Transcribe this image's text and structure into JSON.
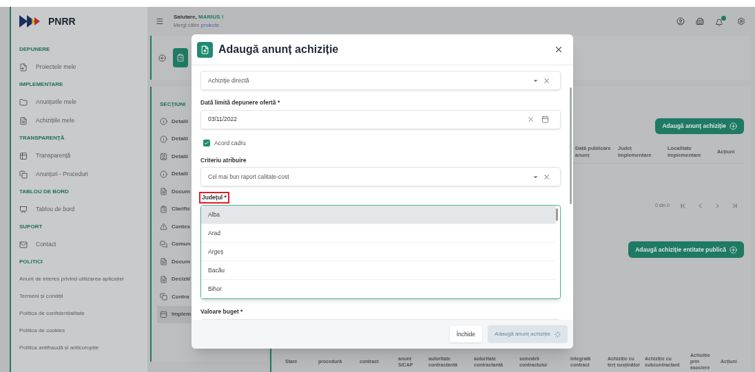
{
  "sidebar": {
    "logo": "PNRR",
    "groups": [
      {
        "title": "DEPUNERE",
        "items": [
          "Proiectele mele"
        ]
      },
      {
        "title": "IMPLEMENTARE",
        "items": [
          "Anunțurile mele",
          "Achizițiile mele"
        ]
      },
      {
        "title": "TRANSPARENȚĂ",
        "items": [
          "Transparență",
          "Anunțuri - Proceduri"
        ]
      },
      {
        "title": "TABLOU DE BORD",
        "items": [
          "Tablou de bord"
        ]
      },
      {
        "title": "SUPORT",
        "items": [
          "Contact"
        ]
      },
      {
        "title": "POLITICI",
        "links": [
          "Anunț de interes privind utilizarea aplicației",
          "Termeni și condiții",
          "Politica de confidențialitate",
          "Politica de cookies",
          "Politica antifraudă și anticorupție"
        ]
      }
    ]
  },
  "header": {
    "greeting": "Salutare,",
    "user": "MARIUS !",
    "hint": "Mergi către",
    "hint_link": "proiecte",
    "hint_end": "."
  },
  "sections": {
    "title": "SECȚIUNI",
    "items": [
      {
        "label": "Detalii",
        "selected": false
      },
      {
        "label": "Detalii",
        "selected": false
      },
      {
        "label": "Detalii",
        "selected": false
      },
      {
        "label": "Detalii",
        "selected": false
      },
      {
        "label": "Docum",
        "selected": false
      },
      {
        "label": "Clarific",
        "selected": false
      },
      {
        "label": "Contes",
        "selected": false
      },
      {
        "label": "Comun",
        "selected": false
      },
      {
        "label": "Docum",
        "selected": false
      },
      {
        "label": "Decizii/",
        "selected": false
      },
      {
        "label": "Contra",
        "selected": false
      },
      {
        "label": "Implem",
        "selected": true
      }
    ]
  },
  "announcements": {
    "add_button": "Adaugă anunț achiziție",
    "columns": [
      "Dată publicare anunț",
      "Județ implementare",
      "Localitate implementare",
      "Acțiuni"
    ],
    "pagination": "0 din 0"
  },
  "acquisitions": {
    "add_button": "Adaugă achiziție entitate publică",
    "columns": [
      "Stare",
      "procedură",
      "contract",
      "anunț SICAP",
      "autoritate contractantă",
      "autoritate contractantă",
      "semnării contractului",
      "integrală contract",
      "Achiziție cu terț susținător",
      "Achiziție cu subcontractant",
      "Achiziție prin asociere",
      "Acțiuni"
    ]
  },
  "modal": {
    "title": "Adaugă anunț achiziție",
    "fields": [
      {
        "kind": "select",
        "value": "Achiziție directă"
      },
      {
        "kind": "date",
        "label": "Dată limită depunere ofertă *",
        "value": "03/11/2022"
      },
      {
        "kind": "checkbox",
        "label": "Acord cadru",
        "checked": true
      },
      {
        "kind": "select",
        "label": "Criteriu atribuire",
        "value": "Cel mai bun raport calitate-cost"
      },
      {
        "kind": "dropdown",
        "label": "Județul *",
        "annotated": true,
        "options": [
          {
            "label": "Alba",
            "selected": true
          },
          {
            "label": "Arad",
            "selected": false
          },
          {
            "label": "Argeș",
            "selected": false
          },
          {
            "label": "Bacău",
            "selected": false
          },
          {
            "label": "Bihor",
            "selected": false
          }
        ]
      },
      {
        "kind": "text",
        "label": "Valoare buget *"
      }
    ],
    "close_button": "Închide",
    "submit_button": {
      "label": "Adaugă anunț achiziție",
      "disabled": true
    }
  }
}
